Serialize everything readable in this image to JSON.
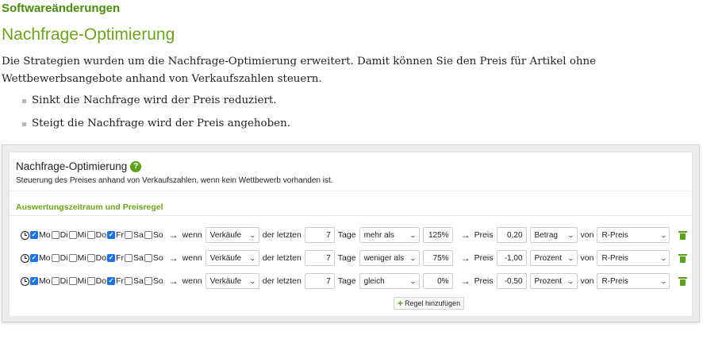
{
  "header": {
    "section_label": "Softwareänderungen",
    "title": "Nachfrage-Optimierung",
    "intro": "Die Strategien wurden um die Nachfrage-Optimierung erweitert. Damit können Sie den Preis für Artikel ohne Wettbewerbsangebote anhand von Verkaufszahlen steuern.",
    "bullets": [
      "Sinkt die Nachfrage wird der Preis reduziert.",
      "Steigt die Nachfrage wird der Preis angehoben."
    ]
  },
  "panel": {
    "title": "Nachfrage-Optimierung",
    "help_icon": "question-circle-icon",
    "help_glyph": "?",
    "subtitle": "Steuerung des Preises anhand von Verkaufszahlen, wenn kein Wettbewerb vorhanden ist.",
    "section_title": "Auswertungszeitraum und Preisregel",
    "labels": {
      "arrow": "→",
      "wenn": "wenn",
      "der_letzten": "der letzten",
      "tage": "Tage",
      "preis": "Preis",
      "von": "von"
    },
    "days": [
      "Mo",
      "Di",
      "Mi",
      "Do",
      "Fr",
      "Sa",
      "So"
    ],
    "rules": [
      {
        "checked": {
          "Mo": true,
          "Di": false,
          "Mi": false,
          "Do": false,
          "Fr": true,
          "Sa": false,
          "So": false
        },
        "metric": "Verkäufe",
        "days_value": "7",
        "comparison": "mehr als",
        "percent": "125%",
        "price_value": "0,20",
        "price_type": "Betrag",
        "price_base": "R-Preis"
      },
      {
        "checked": {
          "Mo": true,
          "Di": false,
          "Mi": false,
          "Do": false,
          "Fr": true,
          "Sa": false,
          "So": false
        },
        "metric": "Verkäufe",
        "days_value": "7",
        "comparison": "weniger als",
        "percent": "75%",
        "price_value": "-1,00",
        "price_type": "Prozent",
        "price_base": "R-Preis"
      },
      {
        "checked": {
          "Mo": true,
          "Di": false,
          "Mi": false,
          "Do": false,
          "Fr": true,
          "Sa": false,
          "So": false
        },
        "metric": "Verkäufe",
        "days_value": "7",
        "comparison": "gleich",
        "percent": "0%",
        "price_value": "-0,50",
        "price_type": "Prozent",
        "price_base": "R-Preis"
      }
    ],
    "add_rule_label": "Regel hinzufügen",
    "add_icon_glyph": "+",
    "accent_color": "#6aa518",
    "checkbox_color": "#1a73e8"
  }
}
